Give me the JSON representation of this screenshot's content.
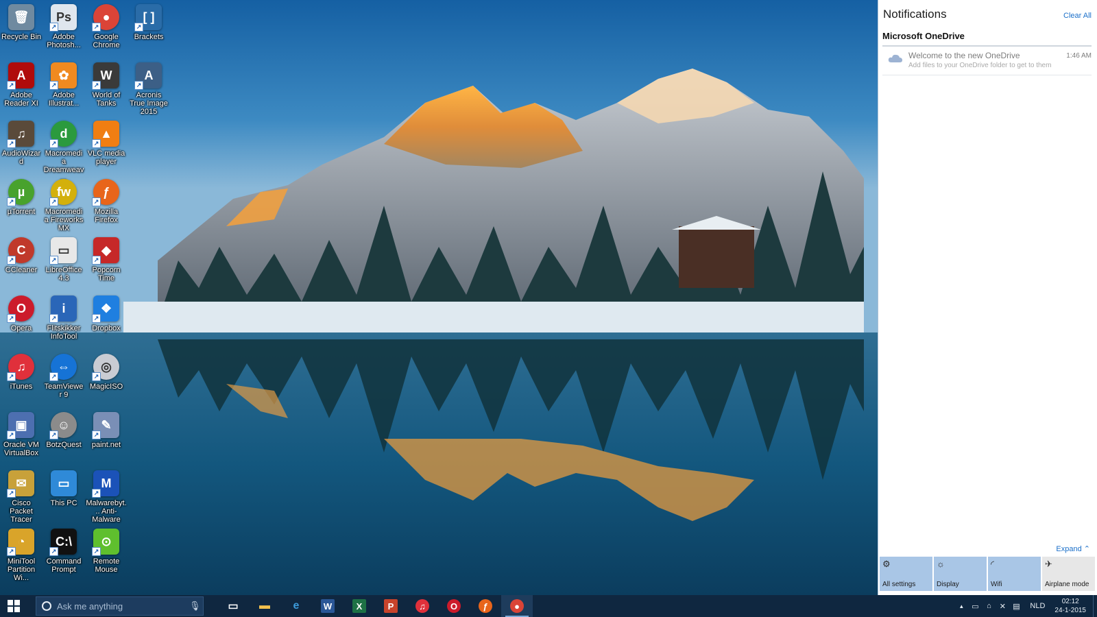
{
  "desktop": {
    "icons": [
      {
        "label": "Recycle Bin",
        "glyph": "🗑",
        "color": "#6f8aa0",
        "round": false,
        "shortcut": false
      },
      {
        "label": "Adobe Photosh...",
        "glyph": "Ps",
        "color": "#dfe6ee",
        "round": false,
        "shortcut": true
      },
      {
        "label": "Google Chrome",
        "glyph": "●",
        "color": "#db4437",
        "round": true,
        "shortcut": true
      },
      {
        "label": "Brackets",
        "glyph": "[ ]",
        "color": "#2a6ca8",
        "round": false,
        "shortcut": true
      },
      {
        "label": "Adobe Reader XI",
        "glyph": "A",
        "color": "#b00b0b",
        "round": false,
        "shortcut": true
      },
      {
        "label": "Adobe Illustrat...",
        "glyph": "✿",
        "color": "#f08a20",
        "round": false,
        "shortcut": true
      },
      {
        "label": "World of Tanks",
        "glyph": "W",
        "color": "#3a3a3a",
        "round": false,
        "shortcut": true
      },
      {
        "label": "Acronis True Image 2015",
        "glyph": "A",
        "color": "#3c5f86",
        "round": false,
        "shortcut": true
      },
      {
        "label": "AudioWizard",
        "glyph": "♫",
        "color": "#5a4a3a",
        "round": false,
        "shortcut": true
      },
      {
        "label": "Macromedia Dreamweav...",
        "glyph": "d",
        "color": "#2b9a3e",
        "round": true,
        "shortcut": true
      },
      {
        "label": "VLC media player",
        "glyph": "▲",
        "color": "#f07e12",
        "round": false,
        "shortcut": true
      },
      {
        "label": "µTorrent",
        "glyph": "µ",
        "color": "#48a22d",
        "round": true,
        "shortcut": true
      },
      {
        "label": "Macromedia Fireworks MX",
        "glyph": "fw",
        "color": "#d3b00c",
        "round": true,
        "shortcut": true
      },
      {
        "label": "Mozilla Firefox",
        "glyph": "ƒ",
        "color": "#e8651b",
        "round": true,
        "shortcut": true
      },
      {
        "label": "CCleaner",
        "glyph": "C",
        "color": "#c0392b",
        "round": true,
        "shortcut": true
      },
      {
        "label": "LibreOffice 4.3",
        "glyph": "▭",
        "color": "#e8e8e8",
        "round": false,
        "shortcut": true
      },
      {
        "label": "Popcorn Time",
        "glyph": "◆",
        "color": "#c62828",
        "round": false,
        "shortcut": true
      },
      {
        "label": "Opera",
        "glyph": "O",
        "color": "#cc1b2b",
        "round": true,
        "shortcut": true
      },
      {
        "label": "Flitskikker InfoTool",
        "glyph": "i",
        "color": "#2a66b8",
        "round": false,
        "shortcut": true
      },
      {
        "label": "Dropbox",
        "glyph": "❖",
        "color": "#1f7fe0",
        "round": false,
        "shortcut": true
      },
      {
        "label": "iTunes",
        "glyph": "♫",
        "color": "#e0303b",
        "round": true,
        "shortcut": true
      },
      {
        "label": "TeamViewer 9",
        "glyph": "⇔",
        "color": "#1673d6",
        "round": true,
        "shortcut": true
      },
      {
        "label": "MagicISO",
        "glyph": "◎",
        "color": "#c9ccd3",
        "round": true,
        "shortcut": true
      },
      {
        "label": "Oracle VM VirtualBox",
        "glyph": "▣",
        "color": "#4d6fb0",
        "round": false,
        "shortcut": true
      },
      {
        "label": "BotzQuest",
        "glyph": "☺",
        "color": "#8b8b8b",
        "round": true,
        "shortcut": true
      },
      {
        "label": "paint.net",
        "glyph": "✎",
        "color": "#7a8fb6",
        "round": false,
        "shortcut": true
      },
      {
        "label": "Cisco Packet Tracer",
        "glyph": "✉",
        "color": "#c8a13a",
        "round": false,
        "shortcut": true
      },
      {
        "label": "This PC",
        "glyph": "▭",
        "color": "#2f8ad8",
        "round": false,
        "shortcut": false
      },
      {
        "label": "Malwarebyt... Anti-Malware",
        "glyph": "M",
        "color": "#1b52b8",
        "round": false,
        "shortcut": true
      },
      {
        "label": "MiniTool Partition Wi...",
        "glyph": "◔",
        "color": "#d9a42a",
        "round": false,
        "shortcut": true
      },
      {
        "label": "Command Prompt",
        "glyph": "C:\\",
        "color": "#111111",
        "round": false,
        "shortcut": true
      },
      {
        "label": "Remote Mouse",
        "glyph": "⊙",
        "color": "#5fbf2e",
        "round": false,
        "shortcut": true
      }
    ]
  },
  "action_center": {
    "title": "Notifications",
    "clear_all": "Clear All",
    "group": "Microsoft OneDrive",
    "notification": {
      "title": "Welcome to the new OneDrive",
      "body": "Add files to your OneDrive folder to get to them",
      "time": "1:46 AM",
      "icon": "cloud-icon"
    },
    "expand": "Expand",
    "tiles": [
      {
        "label": "All settings",
        "icon": "⚙",
        "active": true
      },
      {
        "label": "Display",
        "icon": "☼",
        "active": true
      },
      {
        "label": "Wifi",
        "icon": "◜",
        "active": true
      },
      {
        "label": "Airplane mode",
        "icon": "✈",
        "active": false
      }
    ]
  },
  "taskbar": {
    "search_placeholder": "Ask me anything",
    "apps": [
      {
        "name": "task-view",
        "glyph": "▭",
        "color": "#ffffff"
      },
      {
        "name": "file-explorer",
        "glyph": "▬",
        "color": "#f2c14e"
      },
      {
        "name": "internet-explorer",
        "glyph": "e",
        "color": "#3c9bdb"
      },
      {
        "name": "word",
        "glyph": "W",
        "color": "#2b5797"
      },
      {
        "name": "excel",
        "glyph": "X",
        "color": "#1e7145"
      },
      {
        "name": "powerpoint",
        "glyph": "P",
        "color": "#c8432b"
      },
      {
        "name": "itunes",
        "glyph": "♫",
        "color": "#e0303b"
      },
      {
        "name": "opera",
        "glyph": "O",
        "color": "#cc1b2b"
      },
      {
        "name": "firefox",
        "glyph": "ƒ",
        "color": "#e8651b"
      },
      {
        "name": "chrome",
        "glyph": "●",
        "color": "#db4437"
      }
    ],
    "tray_up_arrow": "▲",
    "language": "NLD",
    "time": "02:12",
    "date": "24-1-2015"
  }
}
